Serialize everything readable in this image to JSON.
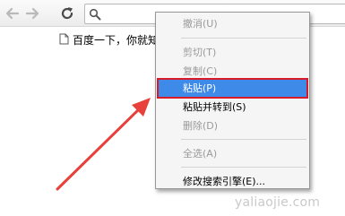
{
  "toolbar": {
    "back_icon": "back-arrow-icon",
    "forward_icon": "forward-arrow-icon",
    "reload_icon": "reload-icon",
    "omnibox_icon": "search-icon"
  },
  "bookmarks": {
    "items": [
      {
        "label": "百度一下，你就知",
        "icon": "page-icon"
      }
    ]
  },
  "context_menu": {
    "items": [
      {
        "label": "撤消(U)",
        "enabled": false,
        "highlighted": false
      },
      {
        "label": "剪切(T)",
        "enabled": false,
        "highlighted": false
      },
      {
        "label": "复制(C)",
        "enabled": false,
        "highlighted": false
      },
      {
        "label": "粘贴(P)",
        "enabled": true,
        "highlighted": true
      },
      {
        "label": "粘贴并转到(S)",
        "enabled": true,
        "highlighted": false
      },
      {
        "label": "删除(D)",
        "enabled": false,
        "highlighted": false
      },
      {
        "label": "全选(A)",
        "enabled": false,
        "highlighted": false
      },
      {
        "label": "修改搜索引擎(E)...",
        "enabled": true,
        "highlighted": false
      }
    ]
  },
  "annotation": {
    "arrow_color": "#e8403a",
    "highlight_border_color": "#d91a2a",
    "highlight_fill_color": "#3d8ae8"
  },
  "watermark": "yaliaojie.com"
}
